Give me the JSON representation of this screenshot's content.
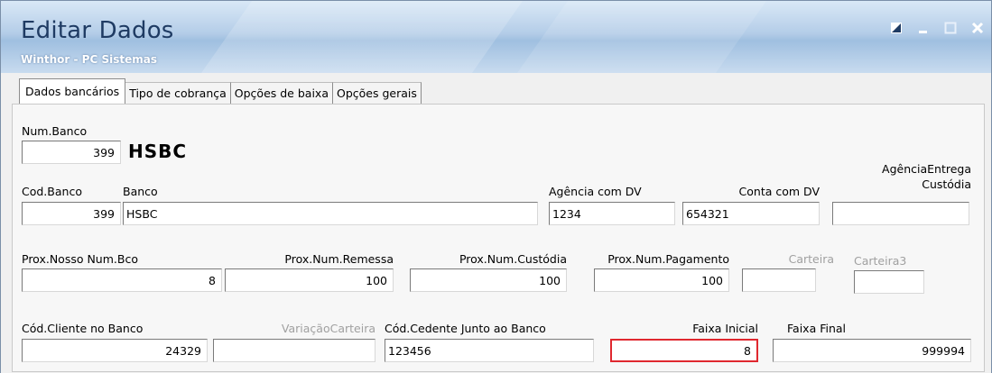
{
  "window": {
    "title": "Editar Dados",
    "subtitle": "Winthor - PC Sistemas",
    "controls": {
      "restore_icon": "restore-icon",
      "minimize_icon": "minimize-icon",
      "maximize_icon": "maximize-icon",
      "close_icon": "close-icon"
    }
  },
  "tabs": [
    {
      "label": "Dados bancários",
      "active": true
    },
    {
      "label": "Tipo de cobrança",
      "active": false
    },
    {
      "label": "Opções de baixa",
      "active": false
    },
    {
      "label": "Opções gerais",
      "active": false
    }
  ],
  "form": {
    "num_banco": {
      "label": "Num.Banco",
      "value": "399"
    },
    "bank_display": "HSBC",
    "cod_banco": {
      "label": "Cod.Banco",
      "value": "399"
    },
    "banco": {
      "label": "Banco",
      "value": "HSBC"
    },
    "agencia_dv": {
      "label": "Agência com DV",
      "value": "1234"
    },
    "conta_dv": {
      "label": "Conta com DV",
      "value": "654321"
    },
    "agencia_entrega": {
      "label_line1": "AgênciaEntrega",
      "label_line2": "Custódia",
      "value": ""
    },
    "prox_nosso_num": {
      "label": "Prox.Nosso Num.Bco",
      "value": "8"
    },
    "prox_num_remessa": {
      "label": "Prox.Num.Remessa",
      "value": "100"
    },
    "prox_num_custodia": {
      "label": "Prox.Num.Custódia",
      "value": "100"
    },
    "prox_num_pagamento": {
      "label": "Prox.Num.Pagamento",
      "value": "100"
    },
    "carteira": {
      "label": "Carteira",
      "value": ""
    },
    "carteira3": {
      "label": "Carteira3",
      "value": ""
    },
    "cod_cliente": {
      "label": "Cód.Cliente no Banco",
      "value": "24329"
    },
    "variacao_carteira": {
      "label": "VariaçãoCarteira",
      "value": ""
    },
    "cod_cedente": {
      "label": "Cód.Cedente Junto ao Banco",
      "value": "123456"
    },
    "faixa_inicial": {
      "label": "Faixa Inicial",
      "value": "8"
    },
    "faixa_final": {
      "label": "Faixa Final",
      "value": "999994"
    }
  },
  "colors": {
    "highlight": "#e0282f",
    "title": "#1f3b63"
  }
}
